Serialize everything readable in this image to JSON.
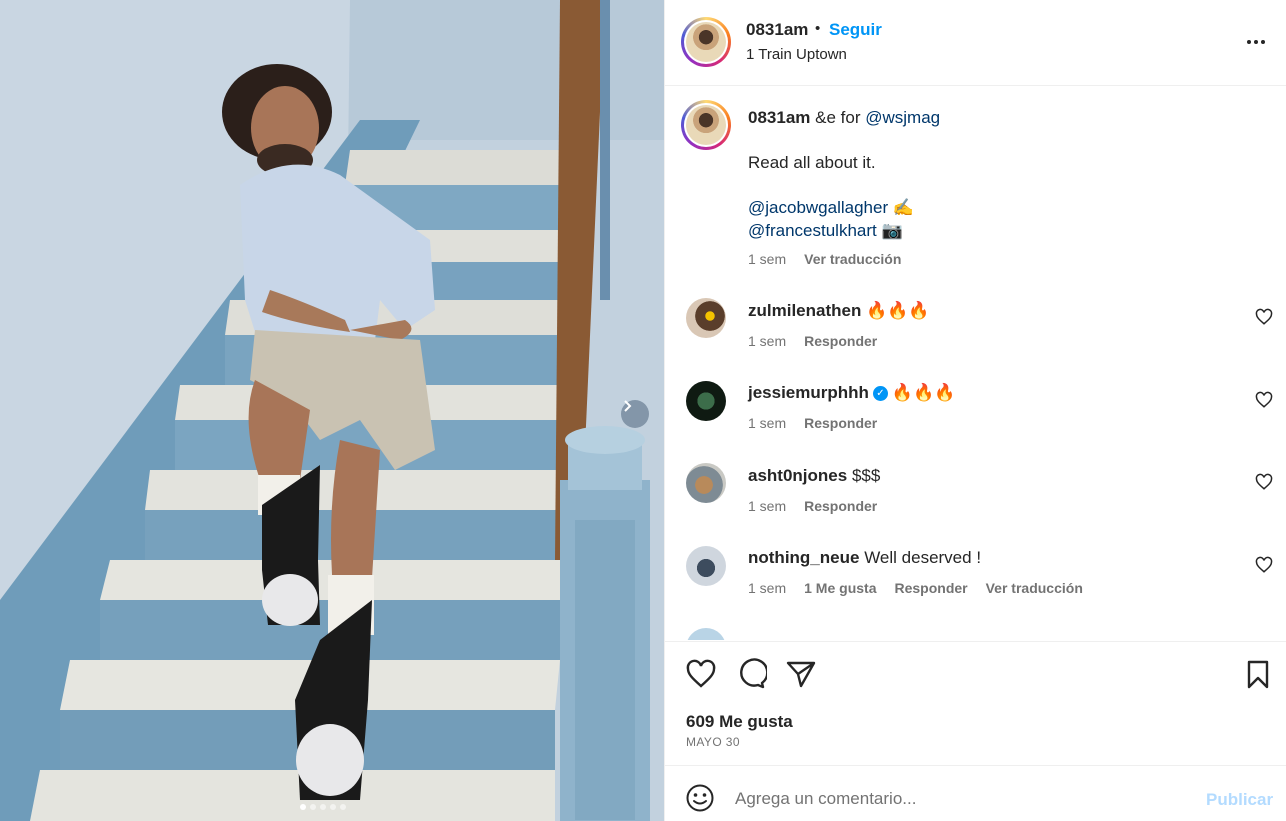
{
  "post": {
    "author": "0831am",
    "follow_label": "Seguir",
    "separator": "•",
    "location": "1 Train Uptown",
    "more_label": "Más opciones"
  },
  "caption": {
    "username": "0831am",
    "text_part": "&e for",
    "mention_wsj": "@wsjmag",
    "body": "Read all about it.",
    "mention_1": "@jacobwgallagher",
    "mention_1_emoji": "✍️",
    "mention_2": "@francestulkhart",
    "mention_2_emoji": "📷",
    "time": "1 sem",
    "translate": "Ver traducción"
  },
  "comments": [
    {
      "username": "zulmilenathen",
      "text": "🔥🔥🔥",
      "time": "1 sem",
      "reply": "Responder",
      "verified": false
    },
    {
      "username": "jessiemurphhh",
      "text": "🔥🔥🔥",
      "time": "1 sem",
      "reply": "Responder",
      "verified": true
    },
    {
      "username": "asht0njones",
      "text": "$$$",
      "time": "1 sem",
      "reply": "Responder",
      "verified": false
    },
    {
      "username": "nothing_neue",
      "text": "Well deserved !",
      "time": "1 sem",
      "likes": "1 Me gusta",
      "reply": "Responder",
      "translate": "Ver traducción",
      "verified": false
    }
  ],
  "actions": {
    "likes_count": "609 Me gusta",
    "date": "MAYO 30"
  },
  "composer": {
    "placeholder": "Agrega un comentario...",
    "publish_label": "Publicar"
  },
  "carousel": {
    "slides": 5,
    "active": 1
  },
  "colors": {
    "accent": "#0095f6",
    "mention": "#00376b",
    "muted": "#737373",
    "publish_disabled": "#b3dbff"
  }
}
